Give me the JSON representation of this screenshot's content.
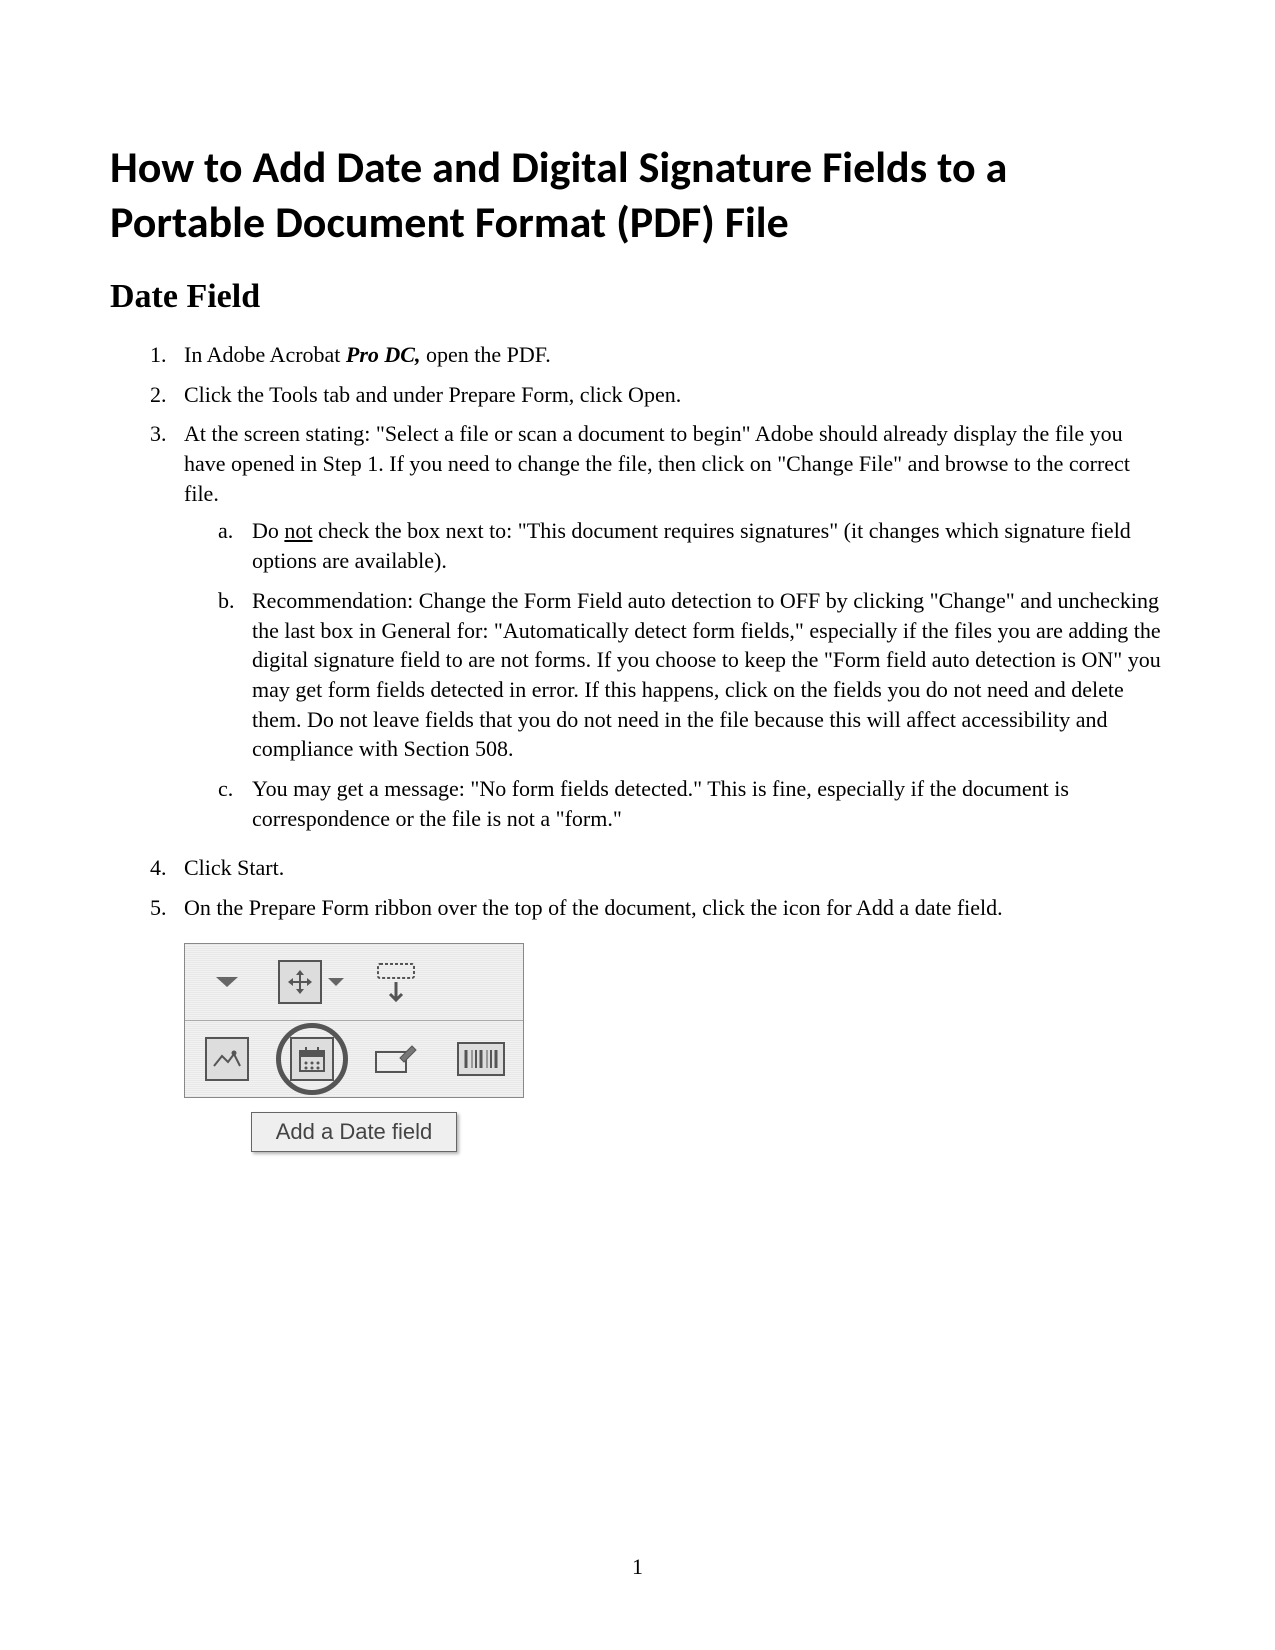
{
  "title": "How to Add Date and Digital Signature Fields to a Portable Document Format (PDF) File",
  "section_heading": "Date Field",
  "steps": {
    "s1_pre": "In Adobe Acrobat ",
    "s1_bold": "Pro DC,",
    "s1_post": " open the PDF.",
    "s2": "Click the Tools tab and under Prepare Form, click Open.",
    "s3": "At the screen stating: \"Select a file or scan a document to begin\" Adobe should already display the file you have opened in Step 1.  If you need to change the file, then click on \"Change File\" and browse to the correct file.",
    "s3a_pre": "Do ",
    "s3a_underline": "not",
    "s3a_post": " check the box next to: \"This document requires signatures\" (it changes which signature field options are available).",
    "s3b": "Recommendation:  Change the Form Field auto detection to OFF by clicking \"Change\" and unchecking the last box in General for: \"Automatically detect form fields,\" especially if the files you are adding the digital signature field to are not forms.  If you choose to keep the \"Form field auto detection is ON\" you may get form fields detected in error.  If this happens, click on the fields you do not need and delete them.  Do not leave fields that you do not need in the file because this will affect accessibility and compliance with Section 508.",
    "s3c": "You may get a message: \"No form fields detected.\"  This is fine, especially if the document is correspondence or the file is not a \"form.\"",
    "s4": "Click Start.",
    "s5": "On the Prepare Form ribbon over the top of the document, click the icon for Add a date field."
  },
  "markers": {
    "n1": "1.",
    "n2": "2.",
    "n3": "3.",
    "n4": "4.",
    "n5": "5.",
    "a": "a.",
    "b": "b.",
    "c": "c."
  },
  "figure": {
    "tooltip": "Add a Date field"
  },
  "page_number": "1"
}
